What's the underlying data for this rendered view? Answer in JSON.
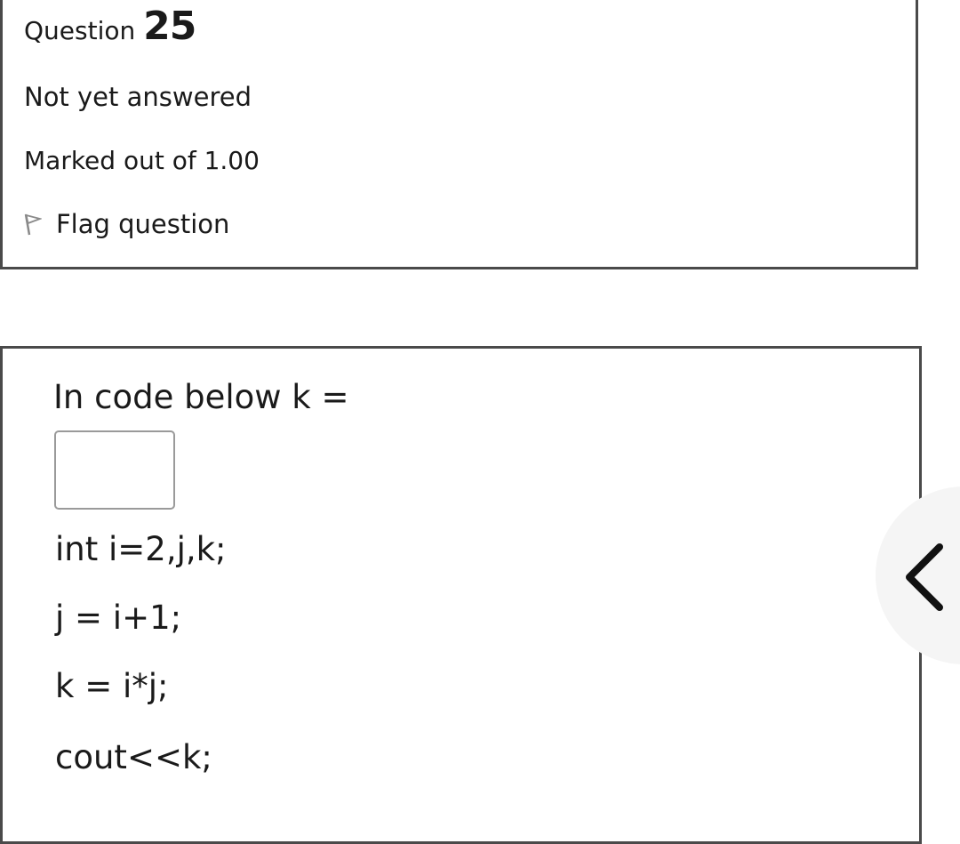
{
  "question_info": {
    "prefix": "Question",
    "number": "25",
    "state": "Not yet answered",
    "grade": "Marked out of 1.00",
    "flag_label": "Flag question",
    "flag_icon": "flag-outline-icon"
  },
  "question": {
    "text": "In code below k =",
    "answer_value": "",
    "code_lines": [
      "int i=2,j,k;",
      "j = i+1;",
      "k = i*j;",
      "cout<<k;"
    ]
  },
  "drawer": {
    "icon": "chevron-left-icon"
  }
}
